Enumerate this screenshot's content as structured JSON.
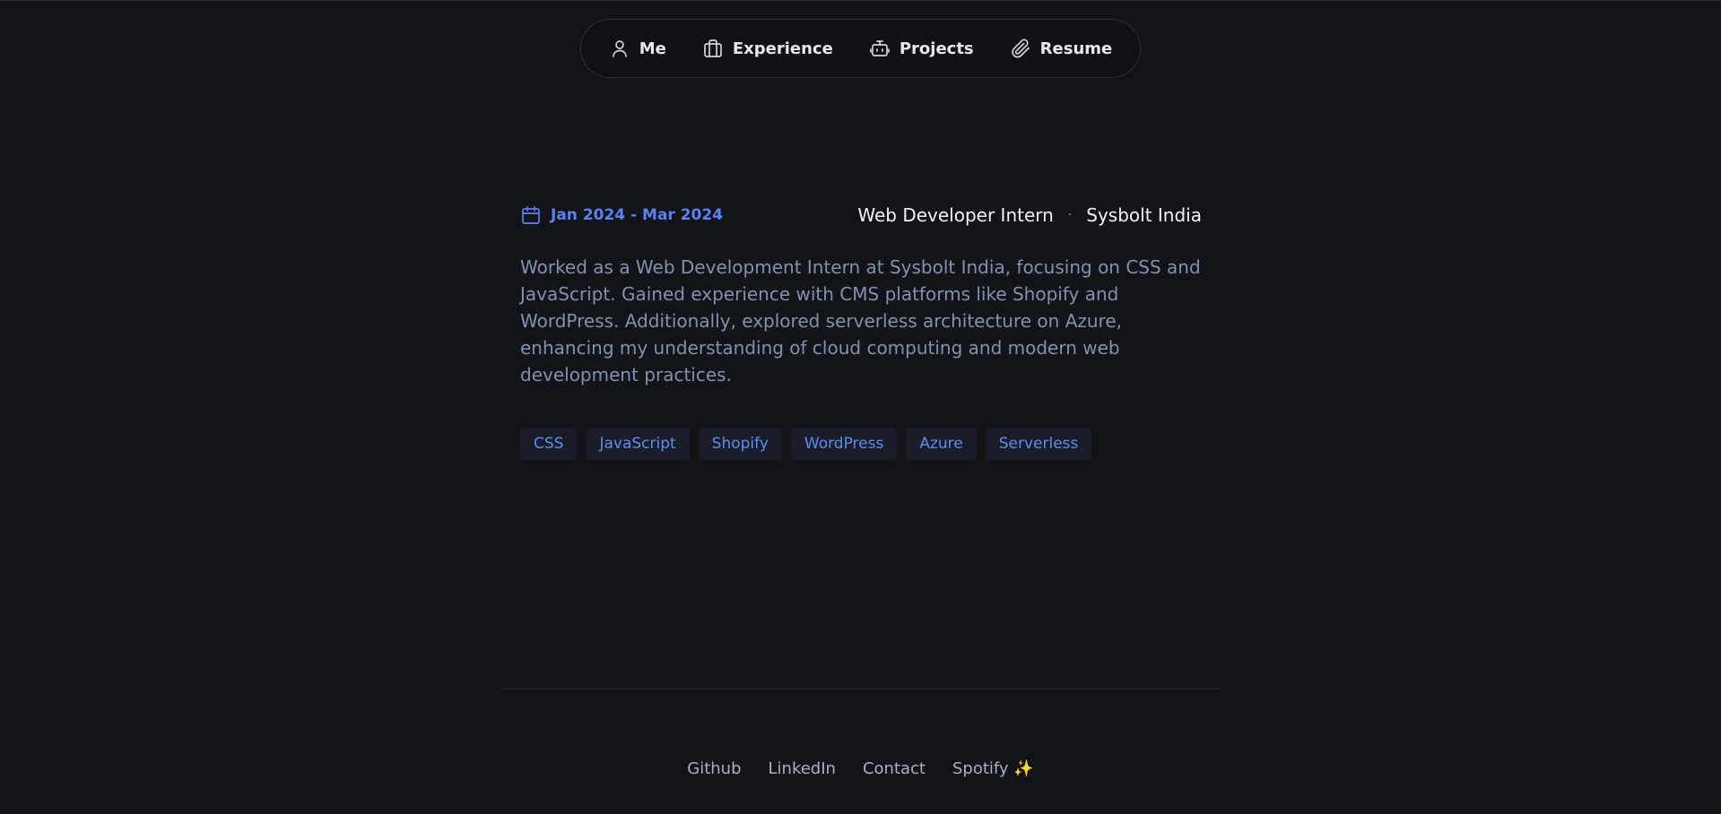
{
  "nav": {
    "items": [
      {
        "label": "Me",
        "icon": "user-icon"
      },
      {
        "label": "Experience",
        "icon": "briefcase-icon"
      },
      {
        "label": "Projects",
        "icon": "robot-icon"
      },
      {
        "label": "Resume",
        "icon": "paperclip-icon"
      }
    ]
  },
  "experience": {
    "date_range": "Jan 2024 - Mar 2024",
    "date_icon": "calendar-icon",
    "role": "Web Developer Intern",
    "separator": "·",
    "company": "Sysbolt India",
    "description": "Worked as a Web Development Intern at Sysbolt India, focusing on CSS and JavaScript. Gained experience with CMS platforms like Shopify and WordPress. Additionally, explored serverless architecture on Azure, enhancing my understanding of cloud computing and modern web development practices.",
    "tags": [
      "CSS",
      "JavaScript",
      "Shopify",
      "WordPress",
      "Azure",
      "Serverless"
    ]
  },
  "footer": {
    "links": [
      "Github",
      "LinkedIn",
      "Contact",
      "Spotify ✨"
    ]
  },
  "colors": {
    "background": "#111419",
    "accent": "#5b82ee",
    "tag_text": "#5b8ef0",
    "body_text": "#8391ac"
  }
}
